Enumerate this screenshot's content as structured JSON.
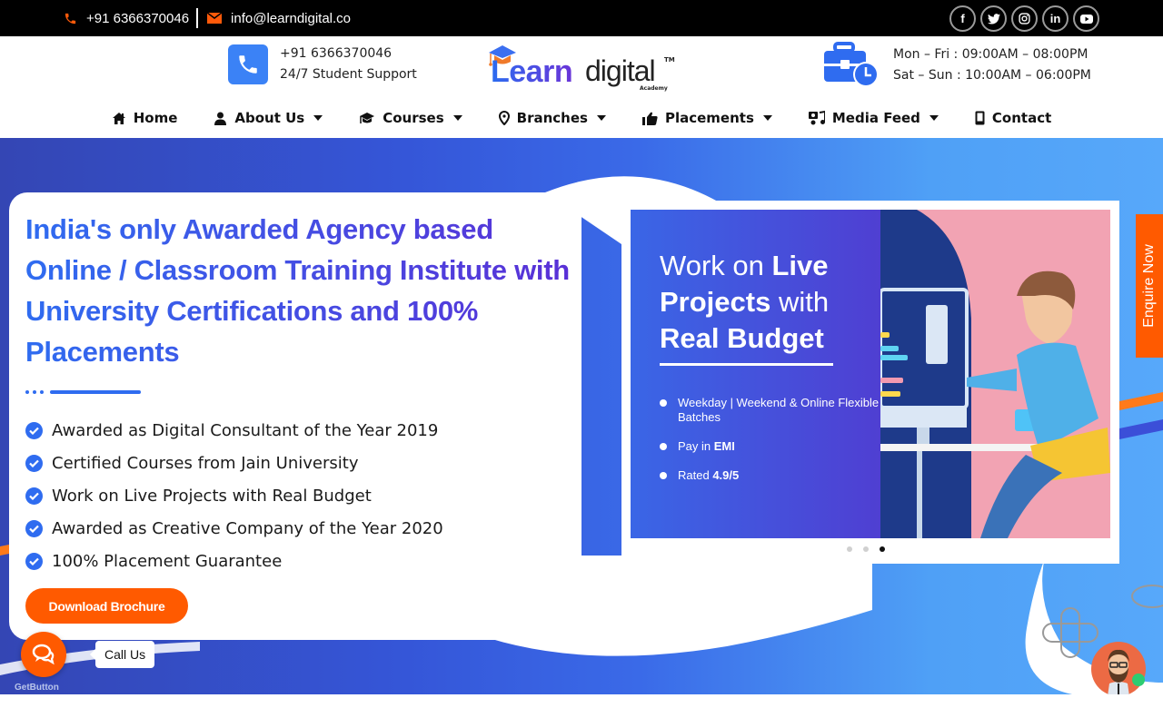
{
  "topbar": {
    "phone": "+91 6366370046",
    "email": "info@learndigital.co",
    "socials": [
      {
        "name": "facebook",
        "glyph": "f"
      },
      {
        "name": "twitter",
        "glyph": "t"
      },
      {
        "name": "instagram",
        "glyph": "◎"
      },
      {
        "name": "linkedin",
        "glyph": "in"
      },
      {
        "name": "youtube",
        "glyph": "▶"
      }
    ]
  },
  "header": {
    "support_phone": "+91 6366370046",
    "support_label": "24/7 Student Support",
    "logo": {
      "learn": "Learn",
      "digital": "digital",
      "tm": "TM",
      "academy": "Academy"
    },
    "hours_weekday": "Mon – Fri : 09:00AM – 08:00PM",
    "hours_weekend": "Sat – Sun : 10:00AM – 06:00PM"
  },
  "nav": [
    {
      "label": "Home",
      "icon": "home-icon",
      "dropdown": false
    },
    {
      "label": "About Us",
      "icon": "user-icon",
      "dropdown": true
    },
    {
      "label": "Courses",
      "icon": "graduation-cap-icon",
      "dropdown": true
    },
    {
      "label": "Branches",
      "icon": "map-pin-icon",
      "dropdown": true
    },
    {
      "label": "Placements",
      "icon": "thumbs-up-icon",
      "dropdown": true
    },
    {
      "label": "Media Feed",
      "icon": "media-icon",
      "dropdown": true
    },
    {
      "label": "Contact",
      "icon": "mobile-icon",
      "dropdown": false
    }
  ],
  "hero": {
    "headline": "India's only Awarded Agency based Online / Classroom Training Institute with University Certifications and 100% Placements",
    "features": [
      "Awarded as Digital Consultant of the Year 2019",
      "Certified Courses from Jain University",
      "Work on Live Projects with Real Budget",
      "Awarded as Creative Company of the Year 2020",
      "100% Placement Guarantee"
    ],
    "brochure_button": "Download Brochure"
  },
  "slider": {
    "title_l1_light": "Work on ",
    "title_l1_bold": "Live",
    "title_l2_bold": "Projects",
    "title_l2_light": " with",
    "title_l3_bold": "Real Budget",
    "bullets": [
      {
        "text": "Weekday | Weekend & Online Flexible Batches",
        "bold": ""
      },
      {
        "text": "Pay in ",
        "bold": "EMI"
      },
      {
        "text": "Rated ",
        "bold": "4.9/5"
      }
    ],
    "total_slides": 3,
    "active_slide": 3
  },
  "enquire_tab": "Enquire Now",
  "call_widget": {
    "label": "Call Us",
    "brand": "GetButton"
  },
  "colors": {
    "accent_blue": "#2f6cf0",
    "accent_orange": "#ff5a00",
    "topbar": "#000000"
  }
}
